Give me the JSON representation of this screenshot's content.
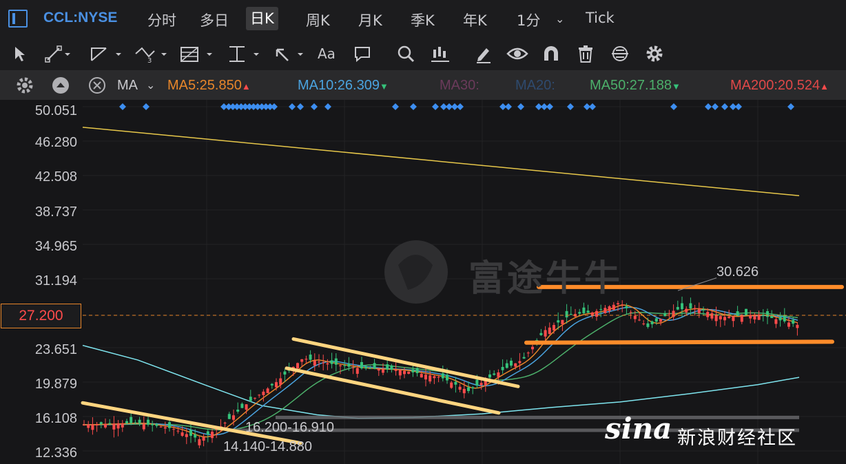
{
  "header": {
    "symbol": "CCL:NYSE",
    "tabs": [
      {
        "label": "分时"
      },
      {
        "label": "多日"
      },
      {
        "label": "日K"
      },
      {
        "label": "周K"
      },
      {
        "label": "月K"
      },
      {
        "label": "季K"
      },
      {
        "label": "年K"
      },
      {
        "label": "1分"
      },
      {
        "label": "Tick"
      }
    ],
    "active_tab": "日K"
  },
  "toolbar": {
    "aa_label": "Aa"
  },
  "ma_bar": {
    "ma_label": "MA",
    "items": [
      {
        "label": "MA5:25.850",
        "arrow": "▲",
        "color": "#e8862a"
      },
      {
        "label": "MA10:26.309",
        "arrow": "▼",
        "color": "#4aa3df"
      },
      {
        "label": "MA30:",
        "arrow": "",
        "color": "#6a3a5a"
      },
      {
        "label": "MA20:",
        "arrow": "",
        "color": "#2e4a6e"
      },
      {
        "label": "MA50:27.188",
        "arrow": "▼",
        "color": "#4caf6a"
      },
      {
        "label": "MA200:20.524",
        "arrow": "▲",
        "color": "#e04848"
      }
    ]
  },
  "chart_data": {
    "type": "candlestick",
    "y_ticks": [
      "50.051",
      "46.280",
      "42.508",
      "38.737",
      "34.965",
      "31.194",
      "27.200",
      "23.651",
      "19.879",
      "16.108",
      "12.336"
    ],
    "current_price": "27.200",
    "annotations": [
      "30.626",
      "16.200-16.910",
      "14.140-14.880"
    ],
    "watermark": "富途牛牛",
    "source": "新浪财经社区",
    "colors": {
      "up": "#ff4b4b",
      "down": "#35c27a",
      "ma5": "#e8862a",
      "ma10": "#4aa3df",
      "ma50": "#4caf6a",
      "ma120": "#7fe6f0",
      "ma250": "#e8c84a",
      "trend": "#ffd580",
      "support": "#ff8c2a"
    }
  }
}
